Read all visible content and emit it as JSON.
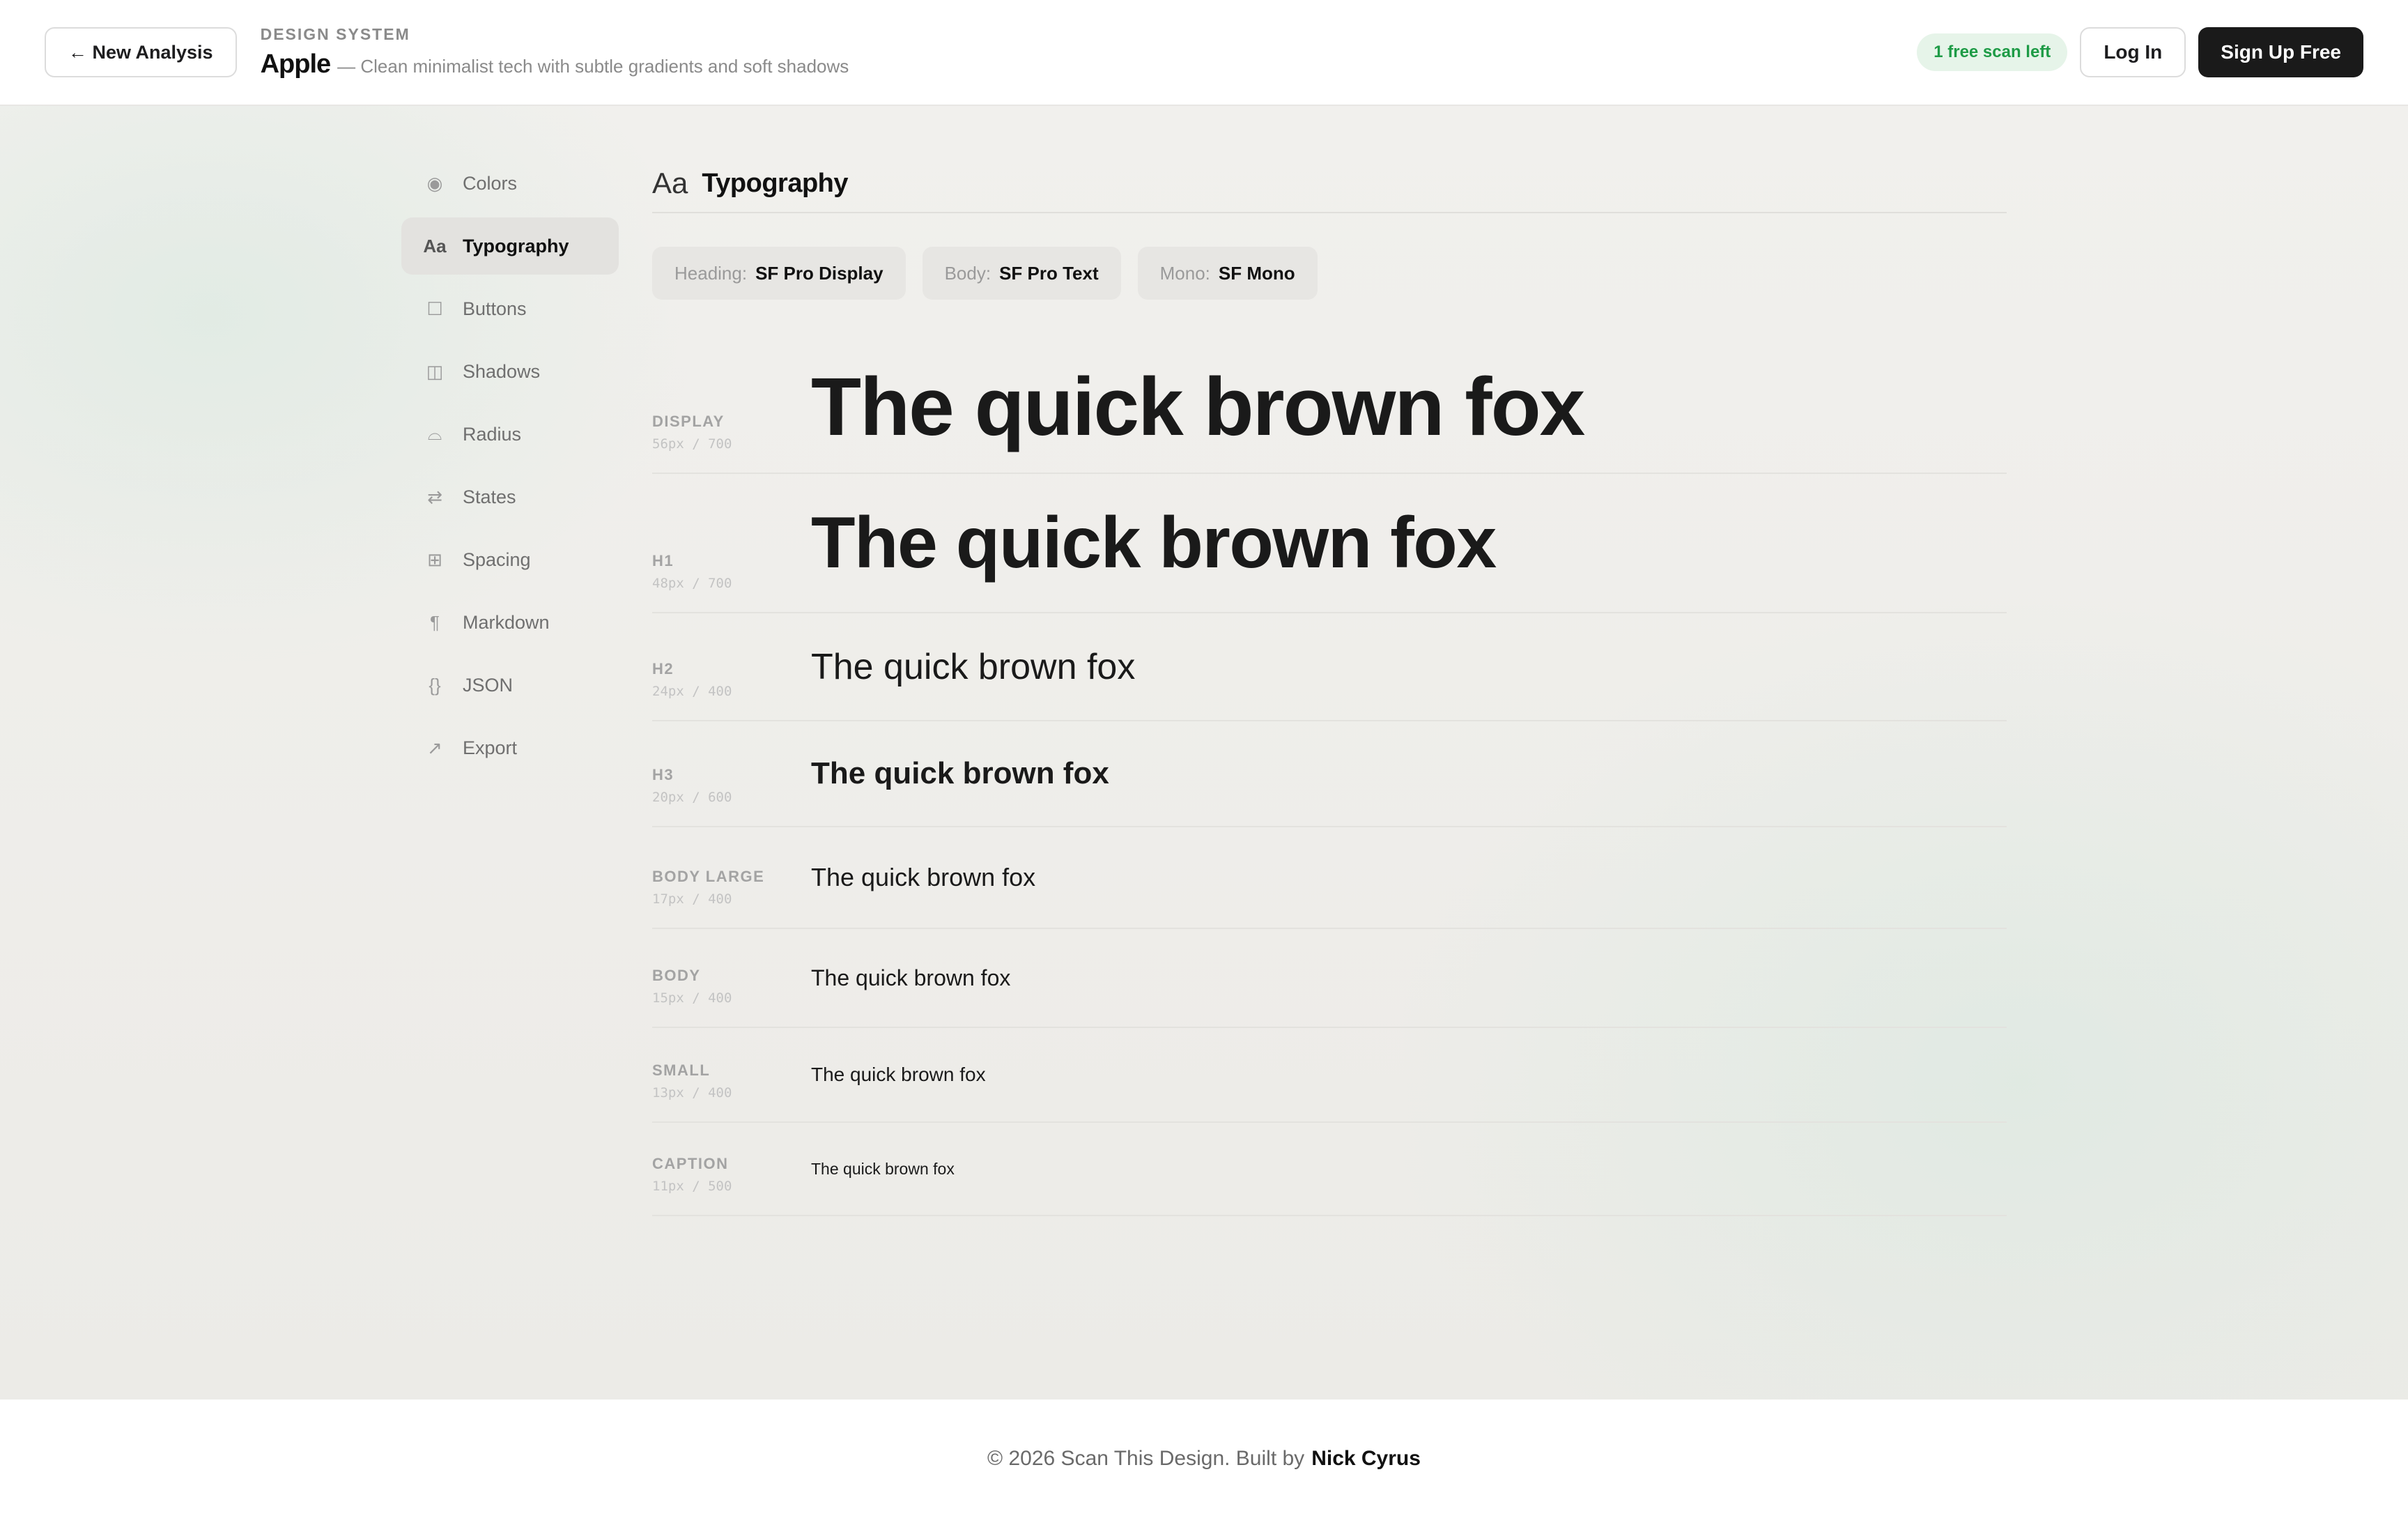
{
  "header": {
    "back_label": "← New Analysis",
    "kicker": "DESIGN SYSTEM",
    "brand_name": "Apple",
    "brand_desc": "— Clean minimalist tech with subtle gradients and soft shadows",
    "scan_badge": "1 free scan left",
    "login_label": "Log In",
    "signup_label": "Sign Up Free"
  },
  "sidebar": {
    "items": [
      {
        "icon": "◉",
        "label": "Colors"
      },
      {
        "icon": "Aa",
        "label": "Typography"
      },
      {
        "icon": "☐",
        "label": "Buttons"
      },
      {
        "icon": "◫",
        "label": "Shadows"
      },
      {
        "icon": "⌓",
        "label": "Radius"
      },
      {
        "icon": "⇄",
        "label": "States"
      },
      {
        "icon": "⊞",
        "label": "Spacing"
      },
      {
        "icon": "¶",
        "label": "Markdown"
      },
      {
        "icon": "{}",
        "label": "JSON"
      },
      {
        "icon": "↗",
        "label": "Export"
      }
    ]
  },
  "content": {
    "section_icon": "Aa",
    "section_title": "Typography",
    "fonts": [
      {
        "key": "Heading:",
        "value": "SF Pro Display"
      },
      {
        "key": "Body:",
        "value": "SF Pro Text"
      },
      {
        "key": "Mono:",
        "value": "SF Mono"
      }
    ],
    "type_scale": [
      {
        "label": "DISPLAY",
        "spec": "56px / 700",
        "sample": "The quick brown fox"
      },
      {
        "label": "H1",
        "spec": "48px / 700",
        "sample": "The quick brown fox"
      },
      {
        "label": "H2",
        "spec": "24px / 400",
        "sample": "The quick brown fox"
      },
      {
        "label": "H3",
        "spec": "20px / 600",
        "sample": "The quick brown fox"
      },
      {
        "label": "BODY LARGE",
        "spec": "17px / 400",
        "sample": "The quick brown fox"
      },
      {
        "label": "BODY",
        "spec": "15px / 400",
        "sample": "The quick brown fox"
      },
      {
        "label": "SMALL",
        "spec": "13px / 400",
        "sample": "The quick brown fox"
      },
      {
        "label": "CAPTION",
        "spec": "11px / 500",
        "sample": "The quick brown fox"
      }
    ]
  },
  "footer": {
    "text": "© 2026 Scan This Design. Built by",
    "author": "Nick Cyrus"
  },
  "colors": {
    "accent": "#1a1a1a",
    "badge_green": "#1e9b46",
    "badge_bg": "#e6f4e9"
  }
}
